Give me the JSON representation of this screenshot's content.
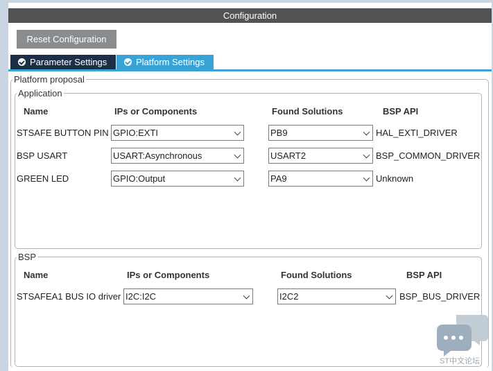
{
  "window": {
    "title": "Configuration"
  },
  "toolbar": {
    "reset_label": "Reset Configuration"
  },
  "tabs": [
    {
      "label": "Parameter Settings",
      "active": false
    },
    {
      "label": "Platform Settings",
      "active": true
    }
  ],
  "platform_proposal": {
    "legend": "Platform proposal",
    "application": {
      "legend": "Application",
      "headers": {
        "name": "Name",
        "ips": "IPs or Components",
        "found": "Found Solutions",
        "bsp_api": "BSP API"
      },
      "rows": [
        {
          "name": "STSAFE BUTTON PIN",
          "ip": "GPIO:EXTI",
          "found": "PB9",
          "bsp_api": "HAL_EXTI_DRIVER"
        },
        {
          "name": "BSP USART",
          "ip": "USART:Asynchronous",
          "found": "USART2",
          "bsp_api": "BSP_COMMON_DRIVER"
        },
        {
          "name": "GREEN LED",
          "ip": "GPIO:Output",
          "found": "PA9",
          "bsp_api": "Unknown"
        }
      ]
    },
    "bsp": {
      "legend": "BSP",
      "headers": {
        "name": "Name",
        "ips": "IPs or Components",
        "found": "Found Solutions",
        "bsp_api": "BSP API"
      },
      "rows": [
        {
          "name": "STSAFEA1 BUS IO driver",
          "ip": "I2C:I2C",
          "found": "I2C2",
          "bsp_api": "BSP_BUS_DRIVER"
        }
      ]
    }
  },
  "watermark": {
    "text": "ST中文论坛",
    "icon": "chat-bubbles-icon"
  },
  "colors": {
    "title_bg": "#525355",
    "tab_active": "#3aa3d6",
    "tab_inactive": "#1d2f47",
    "button": "#8a8d90"
  }
}
